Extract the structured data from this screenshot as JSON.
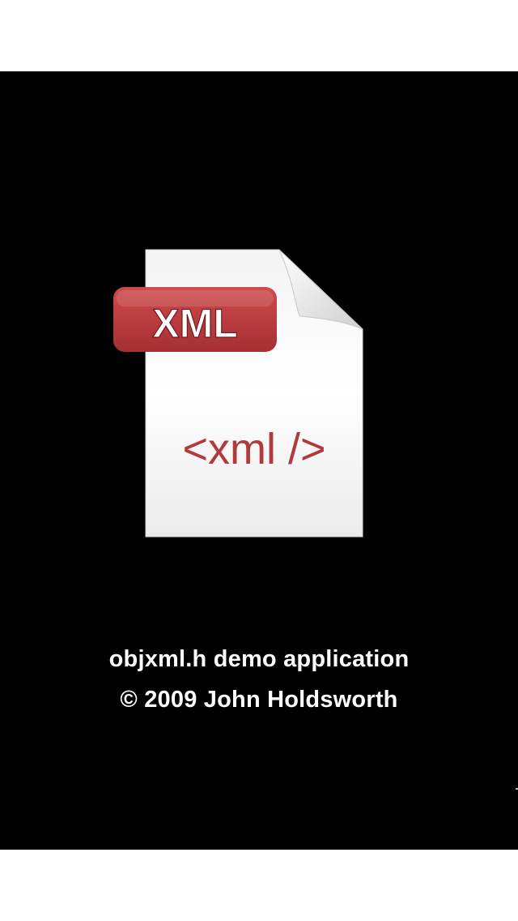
{
  "icon": {
    "badge_text": "XML",
    "tag_text": "<xml />",
    "badge_color": "#b8383b",
    "tag_color": "#b03a3c"
  },
  "credits": {
    "line1": "objxml.h demo application",
    "line2": "© 2009 John Holdsworth"
  }
}
